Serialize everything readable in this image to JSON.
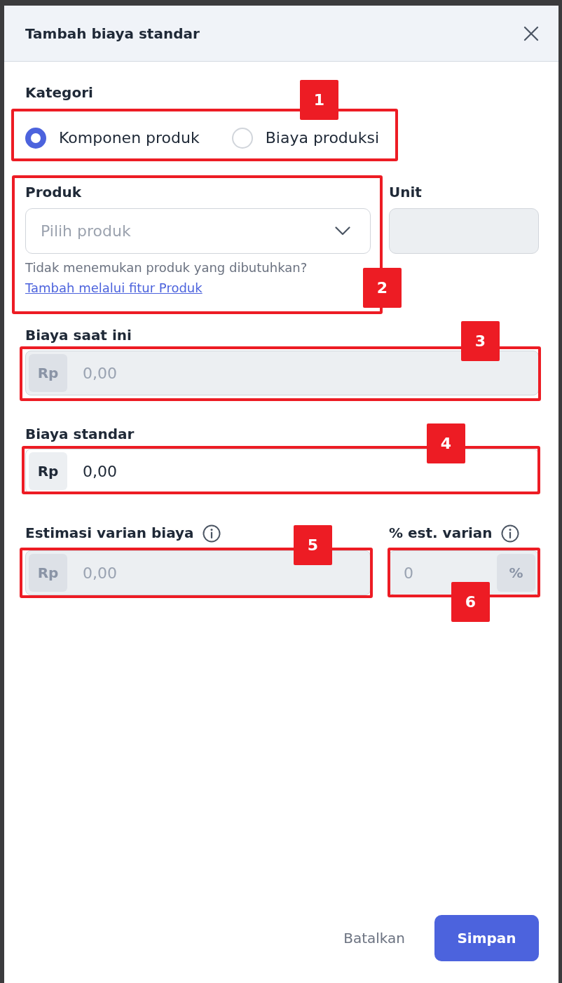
{
  "dialog": {
    "title": "Tambah biaya standar"
  },
  "kategori": {
    "label": "Kategori",
    "callout": "1",
    "options": [
      {
        "label": "Komponen produk",
        "selected": true
      },
      {
        "label": "Biaya produksi",
        "selected": false
      }
    ]
  },
  "produk": {
    "label": "Produk",
    "placeholder": "Pilih produk",
    "helper": "Tidak menemukan produk yang dibutuhkan?",
    "link": "Tambah melalui fitur Produk",
    "callout": "2"
  },
  "unit": {
    "label": "Unit",
    "disabled": true
  },
  "biaya_saat_ini": {
    "label": "Biaya saat ini",
    "prefix": "Rp",
    "placeholder": "0,00",
    "disabled": true,
    "callout": "3"
  },
  "biaya_standar": {
    "label": "Biaya standar",
    "prefix": "Rp",
    "value": "0,00",
    "disabled": false,
    "callout": "4"
  },
  "estimasi_varian": {
    "label": "Estimasi varian biaya",
    "info": true,
    "prefix": "Rp",
    "placeholder": "0,00",
    "disabled": true,
    "callout": "5"
  },
  "persen_varian": {
    "label": "% est. varian",
    "info": true,
    "suffix": "%",
    "placeholder": "0",
    "disabled": true,
    "callout": "6"
  },
  "buttons": [
    {
      "label": "Batalkan",
      "kind": "secondary"
    },
    {
      "label": "Simpan",
      "kind": "primary"
    }
  ]
}
